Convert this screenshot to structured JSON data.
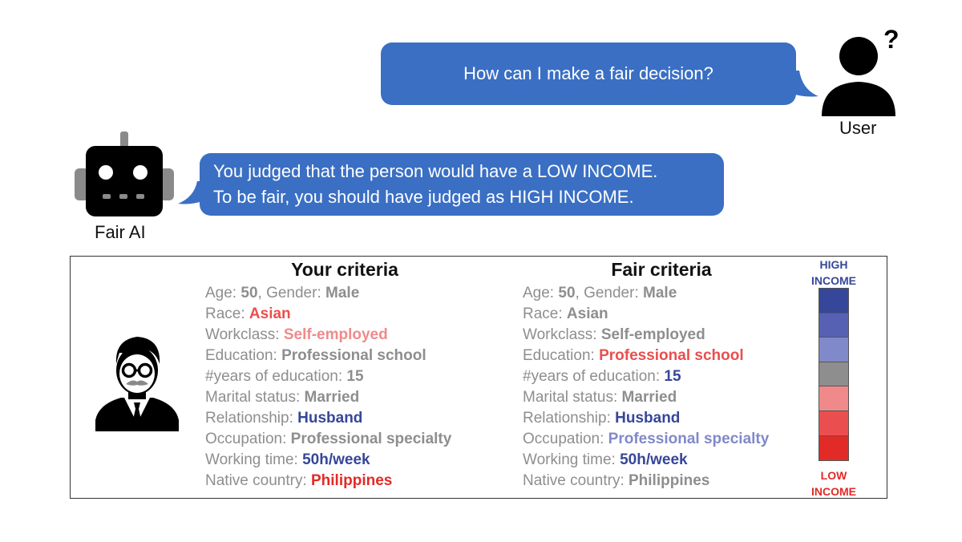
{
  "user": {
    "question": "How can I make a fair decision?",
    "label": "User",
    "icon": "user-icon"
  },
  "ai": {
    "line1": "You judged that the person would have a LOW INCOME.",
    "line2": "To be fair, you should have judged as HIGH INCOME.",
    "label": "Fair AI",
    "icon": "robot-icon"
  },
  "colors": {
    "bubble": "#3a6fc4",
    "high_strong": "#36469a",
    "high_mid": "#5661b4",
    "high_light": "#8089c9",
    "neutral": "#8e8e8e",
    "low_light": "#f08a8a",
    "low_mid": "#eb4e4e",
    "low_strong": "#e22a26"
  },
  "panel": {
    "person_icon": "businessman-icon",
    "your_title": "Your criteria",
    "fair_title": "Fair criteria",
    "your_rows": [
      {
        "label": "Age: ",
        "value": "50",
        "label2": ", Gender: ",
        "value2": "Male",
        "level": "neutral",
        "level2": "neutral"
      },
      {
        "label": "Race: ",
        "value": "Asian",
        "level": "low_mid"
      },
      {
        "label": "Workclass: ",
        "value": "Self-employed",
        "level": "low_light"
      },
      {
        "label": "Education: ",
        "value": "Professional school",
        "level": "neutral"
      },
      {
        "label": "#years of education: ",
        "value": "15",
        "level": "neutral"
      },
      {
        "label": "Marital status: ",
        "value": "Married",
        "level": "neutral"
      },
      {
        "label": "Relationship: ",
        "value": "Husband",
        "level": "high_strong"
      },
      {
        "label": "Occupation: ",
        "value": "Professional specialty",
        "level": "neutral"
      },
      {
        "label": "Working time: ",
        "value": "50h/week",
        "level": "high_strong"
      },
      {
        "label": "Native country: ",
        "value": "Philippines",
        "level": "low_strong"
      }
    ],
    "fair_rows": [
      {
        "label": "Age: ",
        "value": "50",
        "label2": ", Gender: ",
        "value2": "Male",
        "level": "neutral",
        "level2": "neutral"
      },
      {
        "label": "Race: ",
        "value": "Asian",
        "level": "neutral"
      },
      {
        "label": "Workclass: ",
        "value": "Self-employed",
        "level": "neutral"
      },
      {
        "label": "Education: ",
        "value": "Professional school",
        "level": "low_mid"
      },
      {
        "label": "#years of education: ",
        "value": "15",
        "level": "high_strong"
      },
      {
        "label": "Marital status: ",
        "value": "Married",
        "level": "neutral"
      },
      {
        "label": "Relationship: ",
        "value": "Husband",
        "level": "high_strong"
      },
      {
        "label": "Occupation: ",
        "value": "Professional specialty",
        "level": "high_light"
      },
      {
        "label": "Working time: ",
        "value": "50h/week",
        "level": "high_strong"
      },
      {
        "label": "Native country: ",
        "value": "Philippines",
        "level": "neutral"
      }
    ],
    "legend": {
      "high_line1": "HIGH",
      "high_line2": "INCOME",
      "low_line1": "LOW",
      "low_line2": "INCOME",
      "scale": [
        "high_strong",
        "high_mid",
        "high_light",
        "neutral",
        "low_light",
        "low_mid",
        "low_strong"
      ]
    }
  }
}
